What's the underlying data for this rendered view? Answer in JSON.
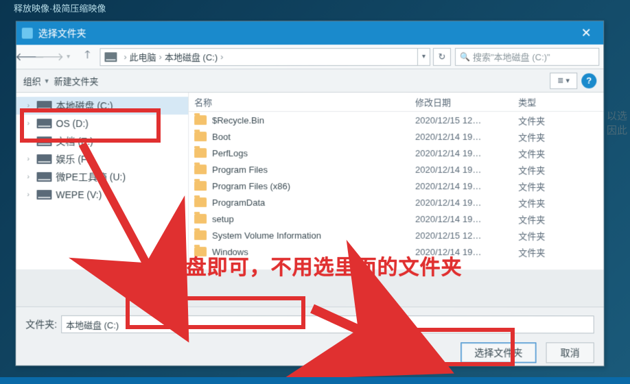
{
  "outer_title": "释放映像·极简压缩映像",
  "right_side_text": "以选\n因此",
  "dialog": {
    "title": "选择文件夹",
    "nav": {
      "pc_label": "此电脑",
      "drive_label": "本地磁盘 (C:)",
      "search_placeholder": "搜索\"本地磁盘 (C:)\""
    },
    "toolbar": {
      "organize": "组织",
      "new_folder": "新建文件夹"
    },
    "columns": {
      "name": "名称",
      "date": "修改日期",
      "type": "类型"
    },
    "tree": [
      {
        "label": "本地磁盘 (C:)",
        "selected": true
      },
      {
        "label": "OS (D:)",
        "selected": false
      },
      {
        "label": "文档 (E:)",
        "selected": false
      },
      {
        "label": "娱乐 (F:)",
        "selected": false
      },
      {
        "label": "微PE工具箱 (U:)",
        "selected": false
      },
      {
        "label": "WEPE (V:)",
        "selected": false
      }
    ],
    "rows": [
      {
        "name": "$Recycle.Bin",
        "date": "2020/12/15 12…",
        "type": "文件夹"
      },
      {
        "name": "Boot",
        "date": "2020/12/14 19…",
        "type": "文件夹"
      },
      {
        "name": "PerfLogs",
        "date": "2020/12/14 19…",
        "type": "文件夹"
      },
      {
        "name": "Program Files",
        "date": "2020/12/14 19…",
        "type": "文件夹"
      },
      {
        "name": "Program Files (x86)",
        "date": "2020/12/14 19…",
        "type": "文件夹"
      },
      {
        "name": "ProgramData",
        "date": "2020/12/14 19…",
        "type": "文件夹"
      },
      {
        "name": "setup",
        "date": "2020/12/14 19…",
        "type": "文件夹"
      },
      {
        "name": "System Volume Information",
        "date": "2020/12/15 12…",
        "type": "文件夹"
      },
      {
        "name": "Windows",
        "date": "2020/12/14 19…",
        "type": "文件夹"
      }
    ],
    "footer": {
      "label": "文件夹:",
      "value": "本地磁盘 (C:)",
      "select_btn": "选择文件夹",
      "cancel_btn": "取消"
    }
  },
  "annotation_text": "选C盘即可，不用选里面的文件夹"
}
